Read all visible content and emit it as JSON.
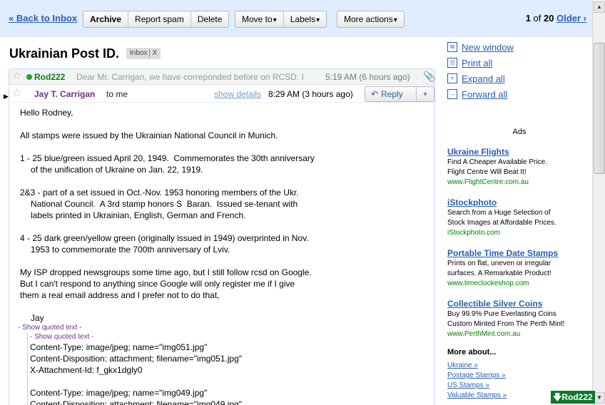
{
  "toolbar": {
    "back_label": "« Back to Inbox",
    "archive_label": "Archive",
    "spam_label": "Report spam",
    "delete_label": "Delete",
    "move_label": "Move to",
    "labels_label": "Labels",
    "more_label": "More actions",
    "dropdown_glyph": "▾",
    "pager_current": "1",
    "pager_of": " of ",
    "pager_total": "20",
    "pager_older": "Older ›"
  },
  "subject": {
    "title": "Ukrainian Post ID.",
    "label": "Inbox",
    "label_close": "X"
  },
  "thread": {
    "collapsed": {
      "sender": "Rod222",
      "snippet": "Dear Mr. Carrigan, we have correponded before on RCSD. I",
      "time": "5:19 AM (6 hours ago)"
    },
    "open": {
      "sender": "Jay T. Carrigan",
      "recipient": "to me",
      "show_details": "show details",
      "time": "8:29 AM (3 hours ago)",
      "reply_label": "Reply"
    },
    "body": {
      "greeting": "Hello Rodney,",
      "line1": "All stamps were issued by the Ukrainian National Council in Munich.",
      "item1a": "1 - 25 blue/green issued April 20, 1949.  Commemorates the 30th anniversary",
      "item1b": "of the unification of Ukraine on Jan. 22, 1919.",
      "item2a": "2&3 - part of a set issued in Oct.-Nov. 1953 honoring members of the Ukr.",
      "item2b": "National Council.  A 3rd stamp honors S  Baran.  Issued se-tenant with",
      "item2c": "labels printed in Ukrainian, English, German and French.",
      "item3a": "4 - 25 dark green/yellow green (originally issued in 1949) overprinted in Nov.",
      "item3b": "1953 to commemorate the 700th anniversary of Lviv.",
      "para1": "My ISP dropped newsgroups some time ago, but I still follow rcsd on Google.",
      "para2": "But I can't respond to anything since Google will only register me if I give",
      "para3": "them a real email address and I prefer not to do that,",
      "signature": "Jay",
      "show_quoted_1": "- Show quoted text -",
      "show_quoted_2": "- Show quoted text -",
      "att1_type": "Content-Type: image/jpeg; name=\"img051.jpg\"",
      "att1_disp": "Content-Disposition: attachment; filename=\"img051.jpg\"",
      "att1_id": "X-Attachment-Id: f_gkx1dgly0",
      "att2_type": "Content-Type: image/jpeg; name=\"img049.jpg\"",
      "att2_disp": "Content-Disposition: attachment; filename=\"img049.jpg\""
    }
  },
  "actions": {
    "new_window": "New window",
    "print_all": "Print all",
    "expand_all": "Expand all",
    "forward_all": "Forward all"
  },
  "ads": {
    "title": "Ads",
    "items": [
      {
        "title": "Ukraine Flights",
        "line1": "Find A Cheaper Available Price.",
        "line2": "Flight Centre Will Beat It!",
        "url": "www.FlightCentre.com.au"
      },
      {
        "title": "iStockphoto",
        "line1": "Search from a Huge Selection of",
        "line2": "Stock Images at Affordable Prices.",
        "url": "iStockphoto.com"
      },
      {
        "title": "Portable Time Date Stamps",
        "line1": "Prints on flat, uneven or irregular",
        "line2": "surfaces. A Remarkable Product!",
        "url": "www.timeclockeshop.com"
      },
      {
        "title": "Collectible Silver Coins",
        "line1": "Buy 99.9% Pure Everlasting Coins",
        "line2": "Custom Minted From The Perth Mint!",
        "url": "www.PerthMint.com.au"
      }
    ]
  },
  "more_about": {
    "title": "More about...",
    "links": [
      "Ukraine »",
      "Postage Stamps »",
      "US Stamps »",
      "Valuable Stamps »"
    ]
  },
  "chat": {
    "badge": "Rod222"
  },
  "colors": {
    "toolbar_bg": "#e0ecff",
    "link": "#2a5db0",
    "online": "#2ca02c",
    "sender_purple": "#6a318f",
    "ad_url_green": "#008000"
  }
}
